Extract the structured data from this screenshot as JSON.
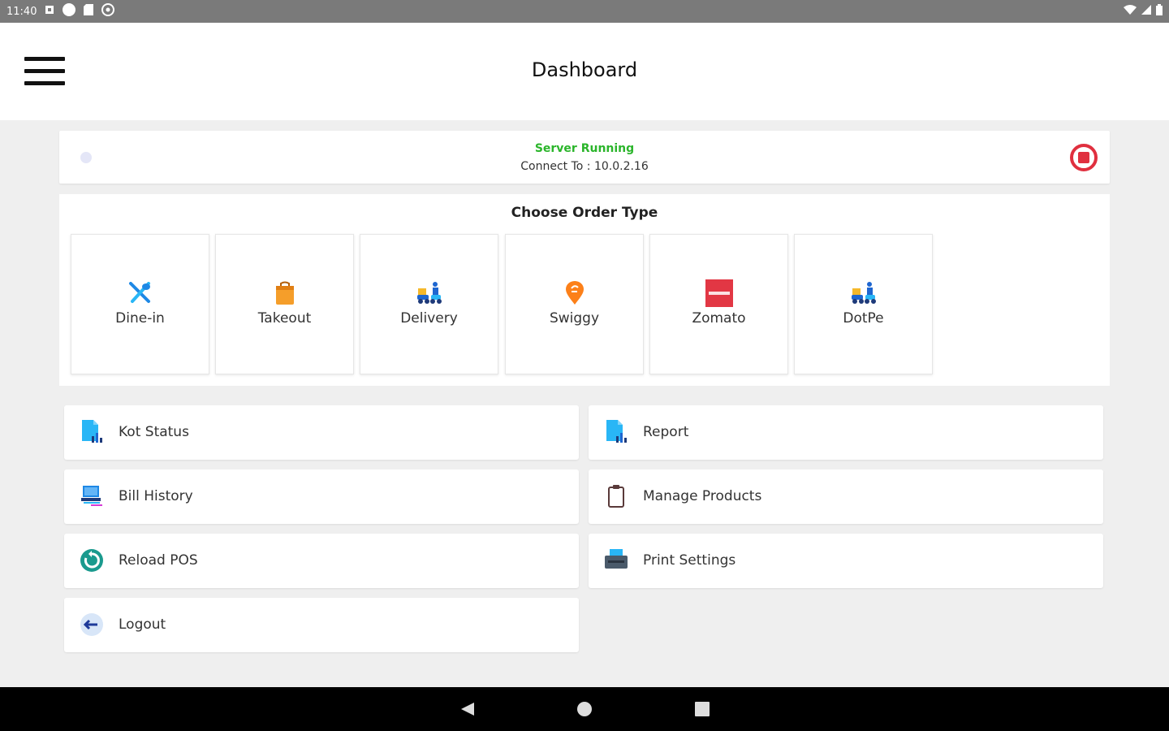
{
  "status_bar": {
    "time": "11:40",
    "icons": [
      "sim-icon",
      "circle-icon",
      "sd-card-icon",
      "at-icon"
    ],
    "right_icons": [
      "wifi-icon",
      "signal-icon",
      "battery-icon"
    ]
  },
  "app_bar": {
    "title": "Dashboard",
    "menu_icon": "hamburger-icon"
  },
  "server": {
    "status": "Server Running",
    "connect": "Connect To : 10.0.2.16",
    "status_color": "#2bb52b",
    "stop_color": "#e0303f"
  },
  "order": {
    "title": "Choose Order Type",
    "types": [
      {
        "label": "Dine-in",
        "icon": "dine-in-icon"
      },
      {
        "label": "Takeout",
        "icon": "takeout-bag-icon"
      },
      {
        "label": "Delivery",
        "icon": "delivery-scooter-icon"
      },
      {
        "label": "Swiggy",
        "icon": "swiggy-icon"
      },
      {
        "label": "Zomato",
        "icon": "zomato-icon"
      },
      {
        "label": "DotPe",
        "icon": "delivery-scooter-icon"
      }
    ]
  },
  "menu": {
    "items": [
      {
        "label": "Kot Status",
        "icon": "document-chart-icon"
      },
      {
        "label": "Report",
        "icon": "document-chart-icon"
      },
      {
        "label": "Bill History",
        "icon": "bill-history-icon"
      },
      {
        "label": "Manage Products",
        "icon": "clipboard-icon"
      },
      {
        "label": "Reload POS",
        "icon": "reload-icon"
      },
      {
        "label": "Print Settings",
        "icon": "printer-icon"
      },
      {
        "label": "Logout",
        "icon": "logout-icon"
      }
    ]
  },
  "nav_bar": {
    "icons": [
      "back-icon",
      "home-icon",
      "recents-icon"
    ]
  }
}
